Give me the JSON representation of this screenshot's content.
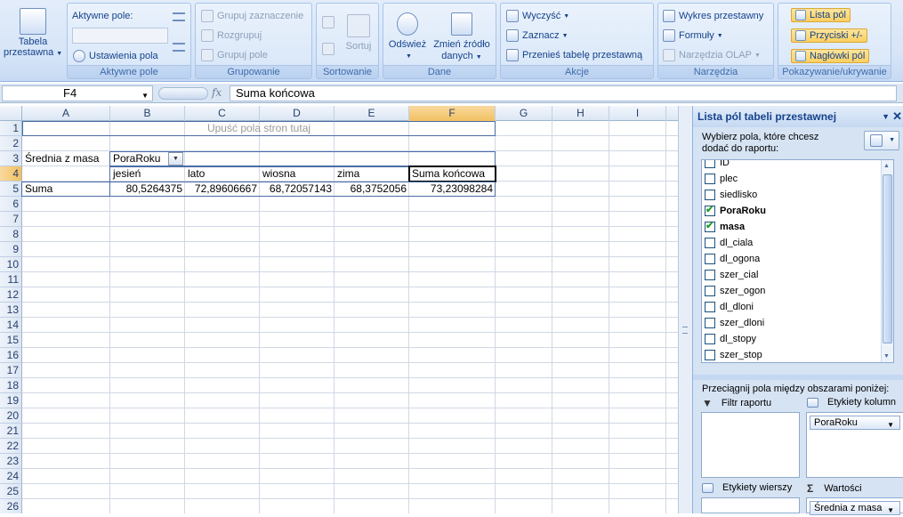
{
  "ribbon": {
    "groups": {
      "pivot": {
        "label": "Tabela przestawna"
      },
      "active_field": {
        "title": "Aktywne pole:",
        "field_settings": "Ustawienia pola",
        "label": "Aktywne pole"
      },
      "group": {
        "group_selection": "Grupuj zaznaczenie",
        "ungroup": "Rozgrupuj",
        "group_field": "Grupuj pole",
        "label": "Grupowanie"
      },
      "sort": {
        "sort": "Sortuj",
        "label": "Sortowanie"
      },
      "data": {
        "refresh": "Odśwież",
        "change_source": "Zmień źródło danych",
        "label": "Dane"
      },
      "actions": {
        "clear": "Wyczyść",
        "select": "Zaznacz",
        "move": "Przenieś tabelę przestawną",
        "label": "Akcje"
      },
      "tools": {
        "pivot_chart": "Wykres przestawny",
        "formulas": "Formuły",
        "olap_tools": "Narzędzia OLAP",
        "label": "Narzędzia"
      },
      "show_hide": {
        "field_list": "Lista pól",
        "buttons": "Przyciski +/-",
        "field_headers": "Nagłówki pól",
        "label": "Pokazywanie/ukrywanie"
      }
    }
  },
  "formula_bar": {
    "name_box": "F4",
    "fx": "fx",
    "formula": "Suma końcowa"
  },
  "sheet": {
    "columns": [
      "A",
      "B",
      "C",
      "D",
      "E",
      "F",
      "G",
      "H",
      "I"
    ],
    "rows": [
      "1",
      "2",
      "3",
      "4",
      "5",
      "6",
      "7",
      "8",
      "9",
      "10",
      "11",
      "12",
      "13",
      "14",
      "15",
      "16",
      "17",
      "18",
      "19",
      "20",
      "21",
      "22",
      "23",
      "24",
      "25",
      "26"
    ],
    "cells": {
      "drop_zone": "Upuść pola stron tutaj",
      "row_label": "Średnia z masa",
      "col_field": "PoraRoku",
      "headers": [
        "jesień",
        "lato",
        "wiosna",
        "zima",
        "Suma końcowa"
      ],
      "total_label": "Suma",
      "values": [
        "80,5264375",
        "72,89606667",
        "68,72057143",
        "68,3752056",
        "73,23098284"
      ]
    }
  },
  "pane": {
    "title": "Lista pól tabeli przestawnej",
    "instruction": "Wybierz pola, które chcesz dodać do raportu:",
    "fields": [
      {
        "name": "ID",
        "checked": false
      },
      {
        "name": "plec",
        "checked": false
      },
      {
        "name": "siedlisko",
        "checked": false
      },
      {
        "name": "PoraRoku",
        "checked": true
      },
      {
        "name": "masa",
        "checked": true
      },
      {
        "name": "dl_ciala",
        "checked": false
      },
      {
        "name": "dl_ogona",
        "checked": false
      },
      {
        "name": "szer_cial",
        "checked": false
      },
      {
        "name": "szer_ogon",
        "checked": false
      },
      {
        "name": "dl_dloni",
        "checked": false
      },
      {
        "name": "szer_dloni",
        "checked": false
      },
      {
        "name": "dl_stopy",
        "checked": false
      },
      {
        "name": "szer_stop",
        "checked": false
      }
    ],
    "drag_instruction": "Przeciągnij pola między obszarami poniżej:",
    "areas": {
      "report_filter": "Filtr raportu",
      "column_labels": "Etykiety kolumn",
      "column_chip": "PoraRoku",
      "row_labels": "Etykiety wierszy",
      "values": "Wartości",
      "values_chip": "Średnia z masa"
    }
  }
}
